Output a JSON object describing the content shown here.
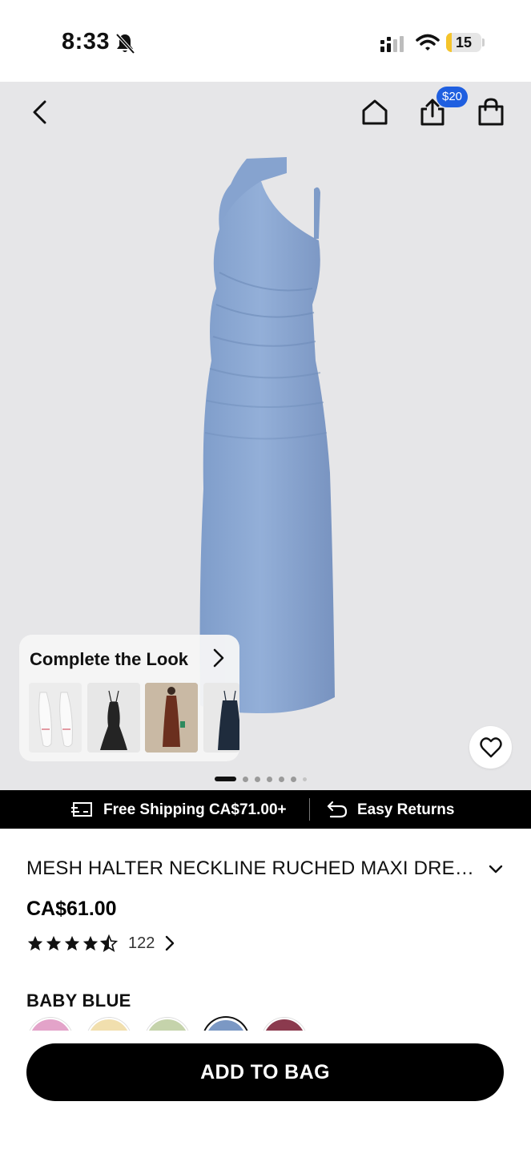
{
  "status_bar": {
    "time": "8:33",
    "battery_level": "15",
    "battery_fraction": 0.15,
    "battery_color": "#f5c42b",
    "icons": [
      "bell-slash-icon",
      "signal-icon",
      "wifi-icon",
      "battery-icon"
    ]
  },
  "header": {
    "icons": [
      "back-arrow-icon",
      "home-icon",
      "share-icon",
      "shopping-bag-icon"
    ],
    "share_badge": "$20",
    "badge_color": "#1f5fe0"
  },
  "complete_the_look": {
    "title": "Complete the Look",
    "items": [
      "white pointed flats",
      "black satin slip dress",
      "brown halter maxi dress",
      "navy slip dress"
    ]
  },
  "gallery": {
    "image_count": 7,
    "active_index": 0
  },
  "shipping_bar": {
    "shipping_text": "Free Shipping CA$71.00+",
    "returns_text": "Easy Returns"
  },
  "product": {
    "title": "MESH HALTER NECKLINE RUCHED MAXI DRESS",
    "price": "CA$61.00",
    "rating": 4.5,
    "review_count": "122",
    "color_label": "BABY BLUE",
    "swatches": [
      {
        "name": "pink",
        "color": "#e3a3c9"
      },
      {
        "name": "butter",
        "color": "#f1dfae"
      },
      {
        "name": "sage",
        "color": "#c5d3ab"
      },
      {
        "name": "baby blue",
        "color": "#7b98c4",
        "selected": true
      },
      {
        "name": "berry",
        "color": "#8b3a4e"
      }
    ]
  },
  "cta": {
    "add_to_bag": "ADD TO BAG"
  }
}
